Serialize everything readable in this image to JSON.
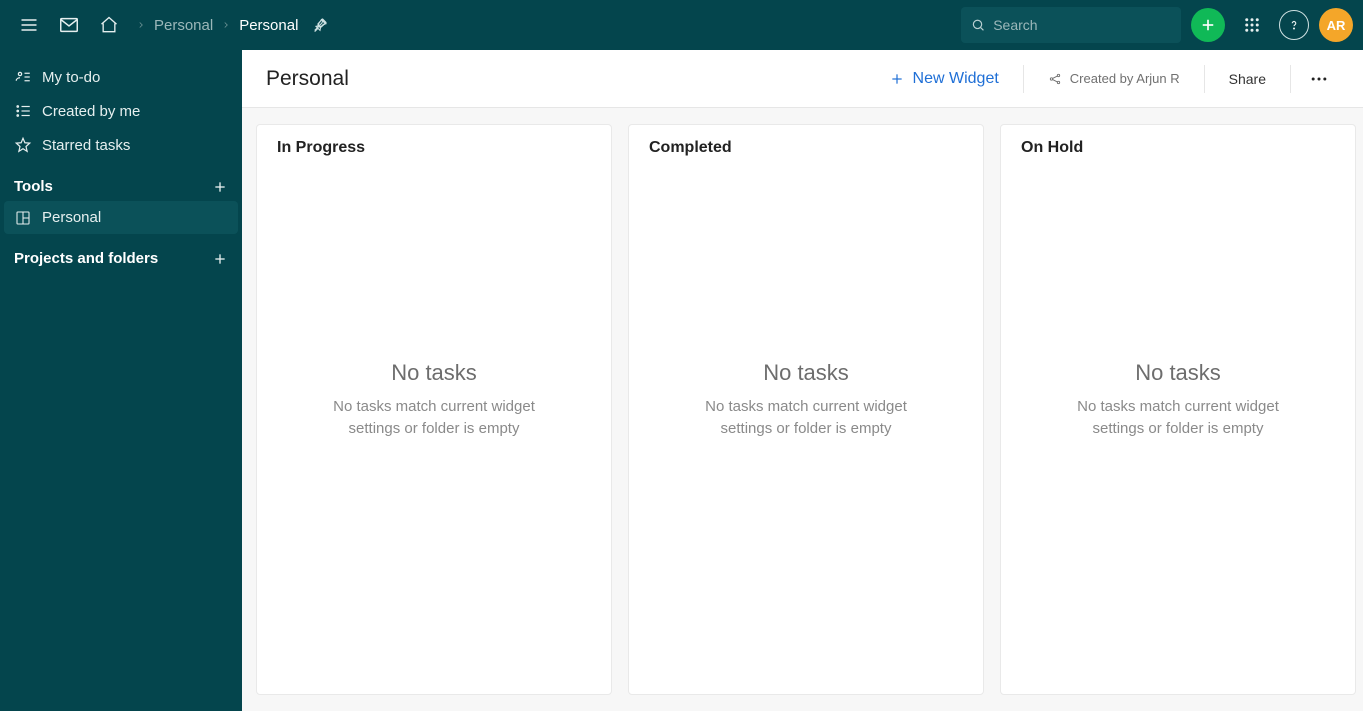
{
  "topbar": {
    "breadcrumb": [
      {
        "label": "Personal",
        "active": false
      },
      {
        "label": "Personal",
        "active": true
      }
    ],
    "search_placeholder": "Search",
    "avatar_initials": "AR"
  },
  "sidebar": {
    "nav": {
      "my_todo": "My to-do",
      "created_by_me": "Created by me",
      "starred_tasks": "Starred tasks"
    },
    "tools_header": "Tools",
    "tool_items": [
      {
        "label": "Personal",
        "selected": true
      }
    ],
    "projects_header": "Projects and folders"
  },
  "content": {
    "title": "Personal",
    "new_widget_label": "New Widget",
    "created_by_label": "Created by Arjun R",
    "share_label": "Share",
    "widgets": [
      {
        "title": "In Progress",
        "empty_title": "No tasks",
        "empty_sub": "No tasks match current widget settings or folder is empty"
      },
      {
        "title": "Completed",
        "empty_title": "No tasks",
        "empty_sub": "No tasks match current widget settings or folder is empty"
      },
      {
        "title": "On Hold",
        "empty_title": "No tasks",
        "empty_sub": "No tasks match current widget settings or folder is empty"
      }
    ]
  }
}
